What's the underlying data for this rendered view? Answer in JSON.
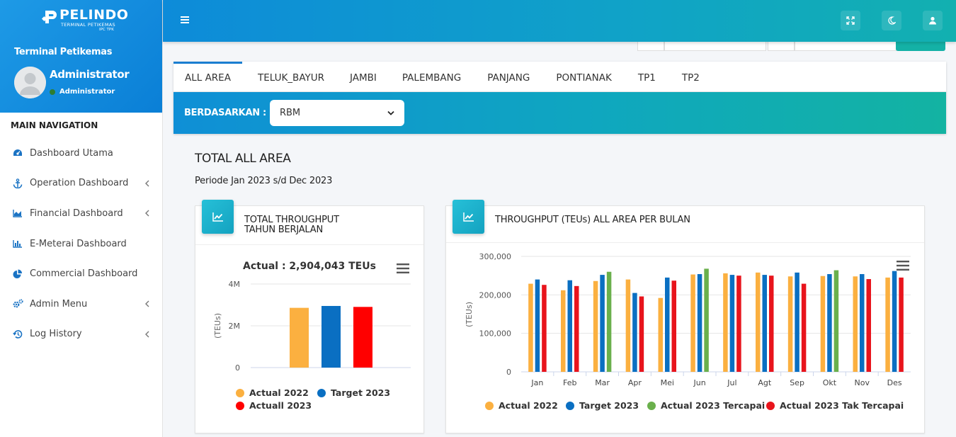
{
  "brand": {
    "name": "PELINDO",
    "sub1": "TERMINAL PETIKEMAS",
    "sub2": "IPC TPK"
  },
  "sidebar": {
    "org_name": "Terminal Petikemas",
    "user_name": "Administrator",
    "user_role": "Administrator",
    "nav_header": "MAIN NAVIGATION",
    "items": [
      {
        "label": "Dashboard Utama",
        "icon": "dashboard-gauge-icon",
        "submenu": false
      },
      {
        "label": "Operation Dashboard",
        "icon": "anchor-icon",
        "submenu": true
      },
      {
        "label": "Financial Dashboard",
        "icon": "area-chart-icon",
        "submenu": true
      },
      {
        "label": "E-Meterai Dashboard",
        "icon": "bar-chart-icon",
        "submenu": false
      },
      {
        "label": "Commercial Dashboard",
        "icon": "pie-chart-icon",
        "submenu": false
      },
      {
        "label": "Admin Menu",
        "icon": "cogs-icon",
        "submenu": true
      },
      {
        "label": "Log History",
        "icon": "history-icon",
        "submenu": true
      }
    ]
  },
  "tabs": [
    "ALL AREA",
    "TELUK_BAYUR",
    "JAMBI",
    "PALEMBANG",
    "PANJANG",
    "PONTIANAK",
    "TP1",
    "TP2"
  ],
  "active_tab": "ALL AREA",
  "filter": {
    "label": "BERDASARKAN :",
    "selected": "RBM"
  },
  "section": {
    "title": "TOTAL ALL AREA",
    "period": "Periode Jan 2023 s/d Dec 2023"
  },
  "card1": {
    "title_line1": "TOTAL THROUGHPUT",
    "title_line2": "TAHUN BERJALAN"
  },
  "card2": {
    "title": "THROUGHPUT (TEUs) ALL AREA PER BULAN"
  },
  "colors": {
    "actual_2022": "#fbb040",
    "target_2023": "#0a6fc2",
    "actual_2023": "#ff0000",
    "tercapai": "#6ab04c",
    "tak_tercapai": "#e8141c"
  },
  "chart_data": [
    {
      "type": "bar",
      "title": "Actual : 2,904,043 TEUs",
      "ylabel": "(TEUs)",
      "yticks": [
        "0",
        "2M",
        "4M"
      ],
      "ylim": [
        0,
        4000000
      ],
      "series": [
        {
          "name": "Actual 2022",
          "values": [
            2860000
          ]
        },
        {
          "name": "Target 2023",
          "values": [
            2950000
          ]
        },
        {
          "name": "Actuall 2023",
          "values": [
            2904043
          ]
        }
      ],
      "legend": "bottom"
    },
    {
      "type": "bar",
      "ylabel": "(TEUs)",
      "yticks": [
        "0",
        "100,000",
        "200,000",
        "300,000"
      ],
      "ylim": [
        0,
        300000
      ],
      "categories": [
        "Jan",
        "Feb",
        "Mar",
        "Apr",
        "Mei",
        "Jun",
        "Jul",
        "Agt",
        "Sep",
        "Okt",
        "Nov",
        "Des"
      ],
      "series": [
        {
          "name": "Actual 2022",
          "values": [
            229000,
            212000,
            236000,
            240000,
            192000,
            253000,
            256000,
            258000,
            248000,
            249000,
            248000,
            245000
          ]
        },
        {
          "name": "Target 2023",
          "values": [
            240000,
            238000,
            252000,
            205000,
            245000,
            254000,
            252000,
            252000,
            258000,
            254000,
            254000,
            262000
          ]
        },
        {
          "name": "Actual 2023",
          "values": [
            226000,
            223000,
            260000,
            196000,
            237000,
            268000,
            250000,
            250000,
            229000,
            264000,
            241000,
            245000
          ]
        }
      ],
      "achieved": [
        false,
        false,
        true,
        false,
        false,
        true,
        false,
        false,
        false,
        true,
        false,
        false
      ],
      "legend_entries": [
        "Actual 2022",
        "Target 2023",
        "Actual 2023 Tercapai",
        "Actual 2023 Tak Tercapai"
      ],
      "legend": "bottom"
    }
  ]
}
